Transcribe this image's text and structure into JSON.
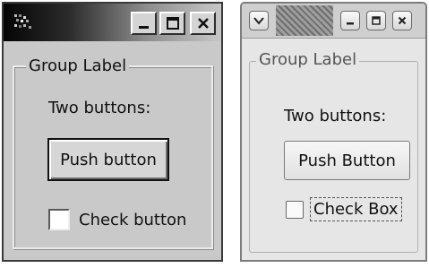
{
  "windows": [
    {
      "theme": "classic",
      "group_label": "Group Label",
      "prompt": "Two buttons:",
      "push_button_label": "Push button",
      "check_label": "Check button",
      "checked": false
    },
    {
      "theme": "gnome",
      "group_label": "Group Label",
      "prompt": "Two buttons:",
      "push_button_label": "Push Button",
      "check_label": "Check Box",
      "checked": false,
      "check_focused": true
    }
  ],
  "icons": [
    "app-icon",
    "minimize-icon",
    "maximize-icon",
    "close-icon",
    "window-menu-icon"
  ]
}
